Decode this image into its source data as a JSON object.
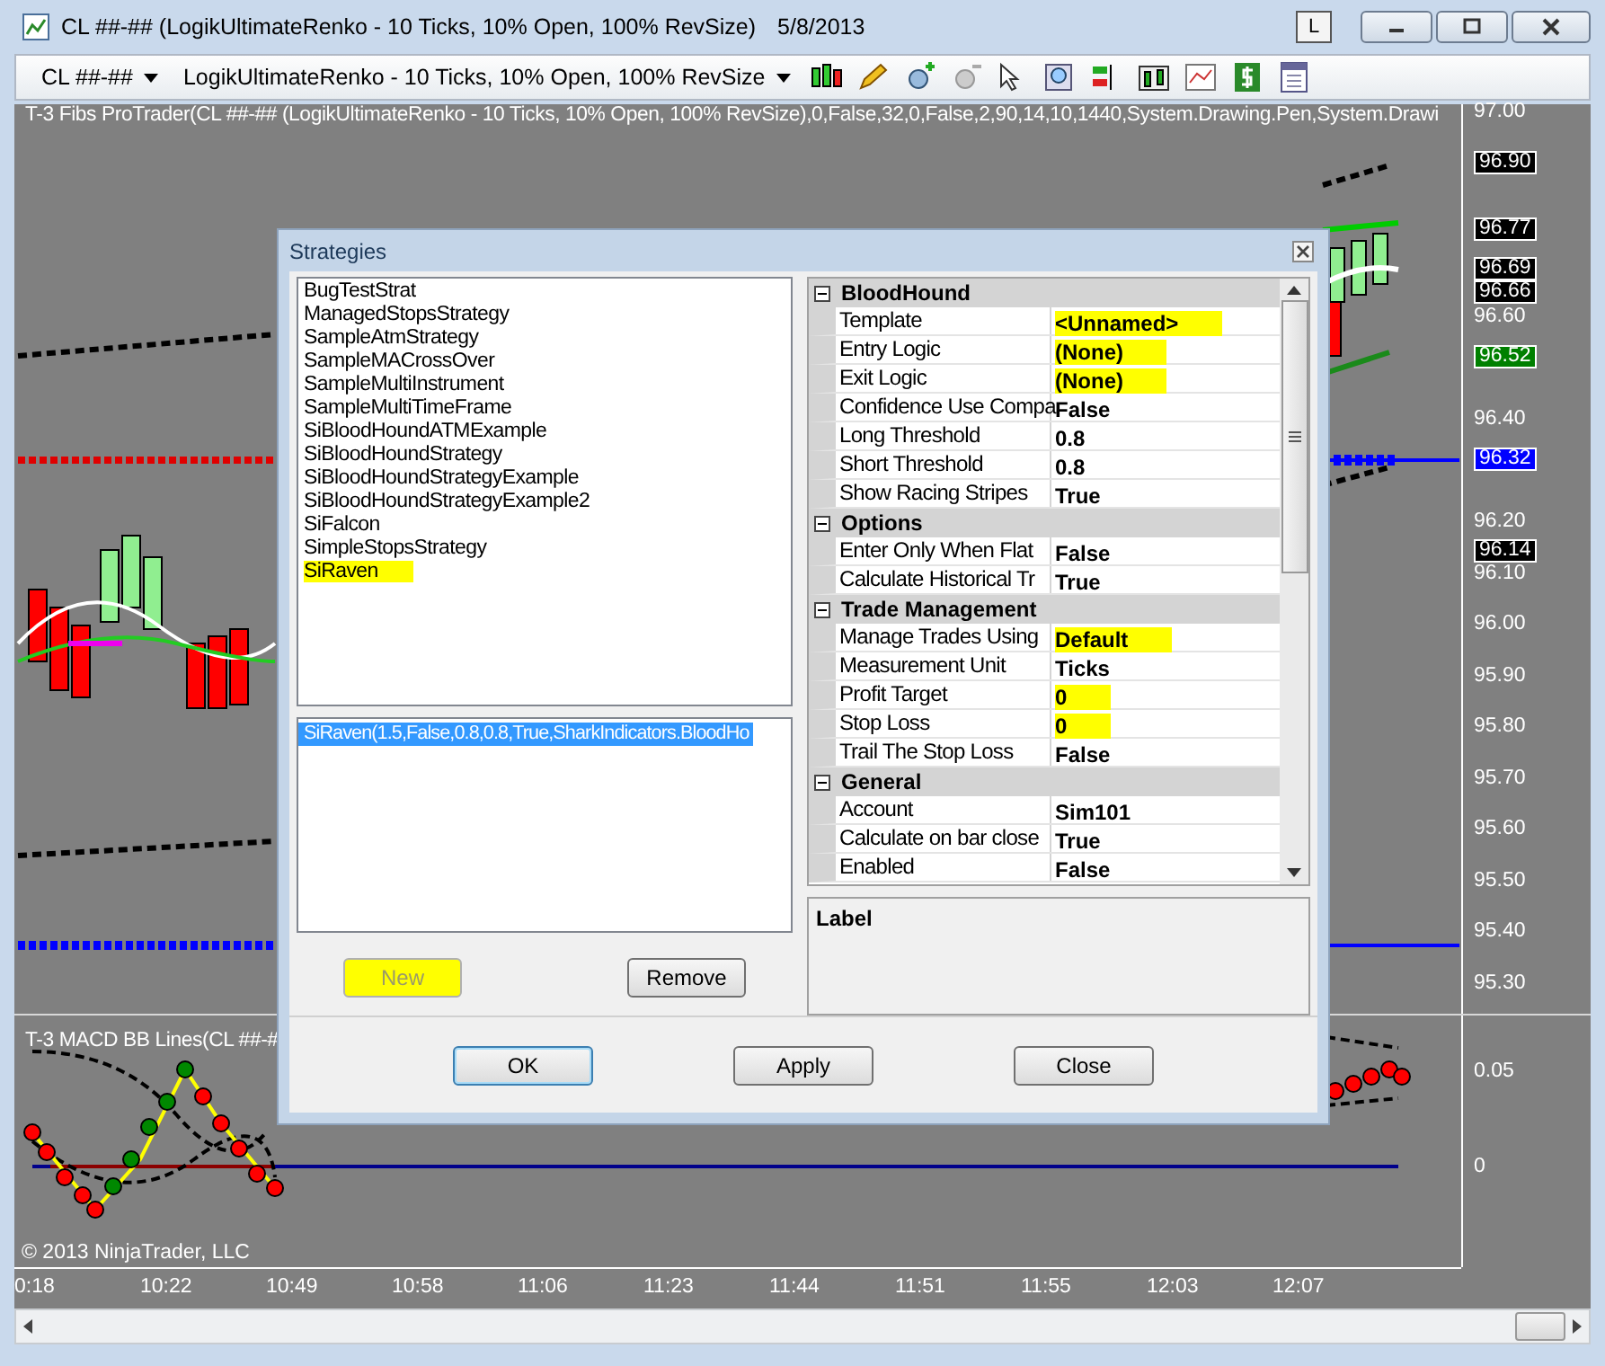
{
  "window": {
    "title": "CL ##-## (LogikUltimateRenko - 10 Ticks, 10% Open, 100% RevSize)",
    "date": "5/8/2013",
    "link_button": "L"
  },
  "toolbar": {
    "instrument": "CL ##-##",
    "bar_type": "LogikUltimateRenko - 10 Ticks, 10% Open, 100% RevSize"
  },
  "price_panel": {
    "indicator_label": "T-3 Fibs ProTrader(CL ##-## (LogikUltimateRenko - 10 Ticks, 10% Open, 100% RevSize),0,False,32,0,False,2,90,14,10,1440,System.Drawing.Pen,System.Drawi",
    "axis_ticks": [
      "97.00",
      "96.60",
      "96.40",
      "96.20",
      "96.10",
      "96.00",
      "95.90",
      "95.80",
      "95.70",
      "95.60",
      "95.50",
      "95.40",
      "95.30"
    ],
    "price_tags": [
      {
        "text": "96.90",
        "color": "#000000"
      },
      {
        "text": "96.77",
        "color": "#000000"
      },
      {
        "text": "96.69",
        "color": "#000000"
      },
      {
        "text": "96.66",
        "color": "#000000"
      },
      {
        "text": "96.52",
        "color": "#008000"
      },
      {
        "text": "96.32",
        "color": "#0000ff"
      },
      {
        "text": "96.14",
        "color": "#000000"
      }
    ]
  },
  "macd_panel": {
    "indicator_label": "T-3 MACD BB Lines(CL ##-#",
    "axis_ticks": [
      "0.05",
      "0"
    ],
    "copyright": "© 2013 NinjaTrader, LLC"
  },
  "time_axis": [
    "0:18",
    "10:22",
    "10:49",
    "10:58",
    "11:06",
    "11:23",
    "11:44",
    "11:51",
    "11:55",
    "12:03",
    "12:07"
  ],
  "dialog": {
    "title": "Strategies",
    "strategies": [
      {
        "name": "BugTestStrat",
        "highlighted": false
      },
      {
        "name": "ManagedStopsStrategy",
        "highlighted": false
      },
      {
        "name": "SampleAtmStrategy",
        "highlighted": false
      },
      {
        "name": "SampleMACrossOver",
        "highlighted": false
      },
      {
        "name": "SampleMultiInstrument",
        "highlighted": false
      },
      {
        "name": "SampleMultiTimeFrame",
        "highlighted": false
      },
      {
        "name": "SiBloodHoundATMExample",
        "highlighted": false
      },
      {
        "name": "SiBloodHoundStrategy",
        "highlighted": false
      },
      {
        "name": "SiBloodHoundStrategyExample",
        "highlighted": false
      },
      {
        "name": "SiBloodHoundStrategyExample2",
        "highlighted": false
      },
      {
        "name": "SiFalcon",
        "highlighted": false
      },
      {
        "name": "SimpleStopsStrategy",
        "highlighted": false
      },
      {
        "name": "SiRaven",
        "highlighted": true
      }
    ],
    "instances": [
      {
        "text": "SiRaven(1.5,False,0.8,0.8,True,SharkIndicators.BloodHo",
        "selected": true
      }
    ],
    "new_button": {
      "label": "New",
      "disabled": true,
      "highlighted": true
    },
    "remove_button": "Remove",
    "properties": [
      {
        "category": "BloodHound",
        "expanded": true,
        "rows": [
          {
            "name": "Template",
            "value": "<Unnamed>",
            "highlighted": true
          },
          {
            "name": "Entry Logic",
            "value": "(None)",
            "highlighted": true
          },
          {
            "name": "Exit Logic",
            "value": "(None)",
            "highlighted": true
          },
          {
            "name": "Confidence Use Compa",
            "value": "False",
            "highlighted": false
          },
          {
            "name": "Long Threshold",
            "value": "0.8",
            "highlighted": false
          },
          {
            "name": "Short Threshold",
            "value": "0.8",
            "highlighted": false
          },
          {
            "name": "Show Racing Stripes",
            "value": "True",
            "highlighted": false
          }
        ]
      },
      {
        "category": "Options",
        "expanded": true,
        "rows": [
          {
            "name": "Enter Only When Flat",
            "value": "False",
            "highlighted": false
          },
          {
            "name": "Calculate Historical Tr",
            "value": "True",
            "highlighted": false
          }
        ]
      },
      {
        "category": "Trade Management",
        "expanded": true,
        "rows": [
          {
            "name": "Manage Trades Using",
            "value": "Default",
            "highlighted": true
          },
          {
            "name": "Measurement Unit",
            "value": "Ticks",
            "highlighted": false
          },
          {
            "name": "Profit Target",
            "value": "0",
            "highlighted": true
          },
          {
            "name": "Stop Loss",
            "value": "0",
            "highlighted": true
          },
          {
            "name": "Trail The Stop Loss",
            "value": "False",
            "highlighted": false
          }
        ]
      },
      {
        "category": "General",
        "expanded": true,
        "rows": [
          {
            "name": "Account",
            "value": "Sim101",
            "highlighted": false
          },
          {
            "name": "Calculate on bar close",
            "value": "True",
            "highlighted": false
          },
          {
            "name": "Enabled",
            "value": "False",
            "highlighted": false
          }
        ]
      }
    ],
    "description_title": "Label",
    "buttons": [
      "OK",
      "Apply",
      "Close"
    ]
  }
}
